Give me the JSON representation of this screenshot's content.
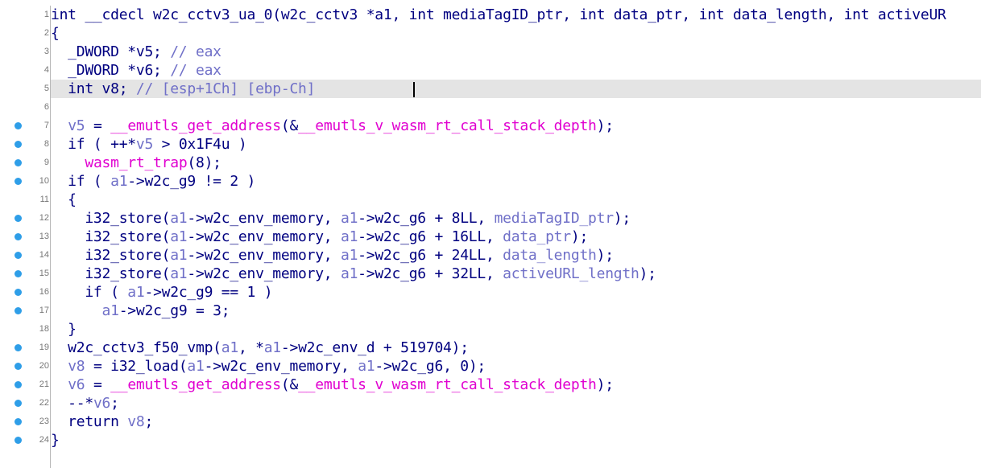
{
  "editor": {
    "caret_line": 5,
    "lines": [
      {
        "no": "1",
        "bp": false,
        "highlight": false,
        "tokens": [
          {
            "t": "int __cdecl w2c_cctv3_ua_0(w2c_cctv3 *a1, int mediaTagID_ptr, int data_ptr, int data_length, int activeUR",
            "c": "plain"
          }
        ]
      },
      {
        "no": "2",
        "bp": false,
        "highlight": false,
        "tokens": [
          {
            "t": "{",
            "c": "plain"
          }
        ]
      },
      {
        "no": "3",
        "bp": false,
        "highlight": false,
        "tokens": [
          {
            "t": "  _DWORD *v5; ",
            "c": "plain"
          },
          {
            "t": "// eax",
            "c": "cmt"
          }
        ]
      },
      {
        "no": "4",
        "bp": false,
        "highlight": false,
        "tokens": [
          {
            "t": "  _DWORD *v6; ",
            "c": "plain"
          },
          {
            "t": "// eax",
            "c": "cmt"
          }
        ]
      },
      {
        "no": "5",
        "bp": false,
        "highlight": true,
        "tokens": [
          {
            "t": "  int v8; ",
            "c": "plain"
          },
          {
            "t": "// [esp+1Ch] [ebp-Ch]",
            "c": "cmt"
          }
        ]
      },
      {
        "no": "6",
        "bp": false,
        "highlight": false,
        "tokens": [
          {
            "t": "",
            "c": "plain"
          }
        ]
      },
      {
        "no": "7",
        "bp": true,
        "highlight": false,
        "tokens": [
          {
            "t": "  ",
            "c": "plain"
          },
          {
            "t": "v5",
            "c": "var"
          },
          {
            "t": " = ",
            "c": "plain"
          },
          {
            "t": "__emutls_get_address",
            "c": "fn"
          },
          {
            "t": "(&",
            "c": "plain"
          },
          {
            "t": "__emutls_v_wasm_rt_call_stack_depth",
            "c": "fn"
          },
          {
            "t": ");",
            "c": "plain"
          }
        ]
      },
      {
        "no": "8",
        "bp": true,
        "highlight": false,
        "tokens": [
          {
            "t": "  if ( ++*",
            "c": "plain"
          },
          {
            "t": "v5",
            "c": "var"
          },
          {
            "t": " > 0x1F4u )",
            "c": "plain"
          }
        ]
      },
      {
        "no": "9",
        "bp": true,
        "highlight": false,
        "tokens": [
          {
            "t": "    ",
            "c": "plain"
          },
          {
            "t": "wasm_rt_trap",
            "c": "fn"
          },
          {
            "t": "(8);",
            "c": "plain"
          }
        ]
      },
      {
        "no": "10",
        "bp": true,
        "highlight": false,
        "tokens": [
          {
            "t": "  if ( ",
            "c": "plain"
          },
          {
            "t": "a1",
            "c": "var"
          },
          {
            "t": "->w2c_g9 != 2 )",
            "c": "plain"
          }
        ]
      },
      {
        "no": "11",
        "bp": false,
        "highlight": false,
        "tokens": [
          {
            "t": "  {",
            "c": "plain"
          }
        ]
      },
      {
        "no": "12",
        "bp": true,
        "highlight": false,
        "tokens": [
          {
            "t": "    i32_store(",
            "c": "plain"
          },
          {
            "t": "a1",
            "c": "var"
          },
          {
            "t": "->w2c_env_memory, ",
            "c": "plain"
          },
          {
            "t": "a1",
            "c": "var"
          },
          {
            "t": "->w2c_g6 + 8LL, ",
            "c": "plain"
          },
          {
            "t": "mediaTagID_ptr",
            "c": "var"
          },
          {
            "t": ");",
            "c": "plain"
          }
        ]
      },
      {
        "no": "13",
        "bp": true,
        "highlight": false,
        "tokens": [
          {
            "t": "    i32_store(",
            "c": "plain"
          },
          {
            "t": "a1",
            "c": "var"
          },
          {
            "t": "->w2c_env_memory, ",
            "c": "plain"
          },
          {
            "t": "a1",
            "c": "var"
          },
          {
            "t": "->w2c_g6 + 16LL, ",
            "c": "plain"
          },
          {
            "t": "data_ptr",
            "c": "var"
          },
          {
            "t": ");",
            "c": "plain"
          }
        ]
      },
      {
        "no": "14",
        "bp": true,
        "highlight": false,
        "tokens": [
          {
            "t": "    i32_store(",
            "c": "plain"
          },
          {
            "t": "a1",
            "c": "var"
          },
          {
            "t": "->w2c_env_memory, ",
            "c": "plain"
          },
          {
            "t": "a1",
            "c": "var"
          },
          {
            "t": "->w2c_g6 + 24LL, ",
            "c": "plain"
          },
          {
            "t": "data_length",
            "c": "var"
          },
          {
            "t": ");",
            "c": "plain"
          }
        ]
      },
      {
        "no": "15",
        "bp": true,
        "highlight": false,
        "tokens": [
          {
            "t": "    i32_store(",
            "c": "plain"
          },
          {
            "t": "a1",
            "c": "var"
          },
          {
            "t": "->w2c_env_memory, ",
            "c": "plain"
          },
          {
            "t": "a1",
            "c": "var"
          },
          {
            "t": "->w2c_g6 + 32LL, ",
            "c": "plain"
          },
          {
            "t": "activeURL_length",
            "c": "var"
          },
          {
            "t": ");",
            "c": "plain"
          }
        ]
      },
      {
        "no": "16",
        "bp": true,
        "highlight": false,
        "tokens": [
          {
            "t": "    if ( ",
            "c": "plain"
          },
          {
            "t": "a1",
            "c": "var"
          },
          {
            "t": "->w2c_g9 == 1 )",
            "c": "plain"
          }
        ]
      },
      {
        "no": "17",
        "bp": true,
        "highlight": false,
        "tokens": [
          {
            "t": "      ",
            "c": "plain"
          },
          {
            "t": "a1",
            "c": "var"
          },
          {
            "t": "->w2c_g9 = 3;",
            "c": "plain"
          }
        ]
      },
      {
        "no": "18",
        "bp": false,
        "highlight": false,
        "tokens": [
          {
            "t": "  }",
            "c": "plain"
          }
        ]
      },
      {
        "no": "19",
        "bp": true,
        "highlight": false,
        "tokens": [
          {
            "t": "  w2c_cctv3_f50_vmp(",
            "c": "plain"
          },
          {
            "t": "a1",
            "c": "var"
          },
          {
            "t": ", *",
            "c": "plain"
          },
          {
            "t": "a1",
            "c": "var"
          },
          {
            "t": "->w2c_env_d + 519704);",
            "c": "plain"
          }
        ]
      },
      {
        "no": "20",
        "bp": true,
        "highlight": false,
        "tokens": [
          {
            "t": "  ",
            "c": "plain"
          },
          {
            "t": "v8",
            "c": "var"
          },
          {
            "t": " = i32_load(",
            "c": "plain"
          },
          {
            "t": "a1",
            "c": "var"
          },
          {
            "t": "->w2c_env_memory, ",
            "c": "plain"
          },
          {
            "t": "a1",
            "c": "var"
          },
          {
            "t": "->w2c_g6, 0);",
            "c": "plain"
          }
        ]
      },
      {
        "no": "21",
        "bp": true,
        "highlight": false,
        "tokens": [
          {
            "t": "  ",
            "c": "plain"
          },
          {
            "t": "v6",
            "c": "var"
          },
          {
            "t": " = ",
            "c": "plain"
          },
          {
            "t": "__emutls_get_address",
            "c": "fn"
          },
          {
            "t": "(&",
            "c": "plain"
          },
          {
            "t": "__emutls_v_wasm_rt_call_stack_depth",
            "c": "fn"
          },
          {
            "t": ");",
            "c": "plain"
          }
        ]
      },
      {
        "no": "22",
        "bp": true,
        "highlight": false,
        "tokens": [
          {
            "t": "  --*",
            "c": "plain"
          },
          {
            "t": "v6",
            "c": "var"
          },
          {
            "t": ";",
            "c": "plain"
          }
        ]
      },
      {
        "no": "23",
        "bp": true,
        "highlight": false,
        "tokens": [
          {
            "t": "  return ",
            "c": "plain"
          },
          {
            "t": "v8",
            "c": "var"
          },
          {
            "t": ";",
            "c": "plain"
          }
        ]
      },
      {
        "no": "24",
        "bp": true,
        "highlight": false,
        "tokens": [
          {
            "t": "}",
            "c": "plain"
          }
        ]
      }
    ]
  },
  "colors": {
    "plain": "#000080",
    "var": "#7070c8",
    "function": "#e000d0",
    "comment": "#7070c8",
    "breakpoint": "#2e9ee8",
    "highlight_bg": "#e4e4e4"
  }
}
